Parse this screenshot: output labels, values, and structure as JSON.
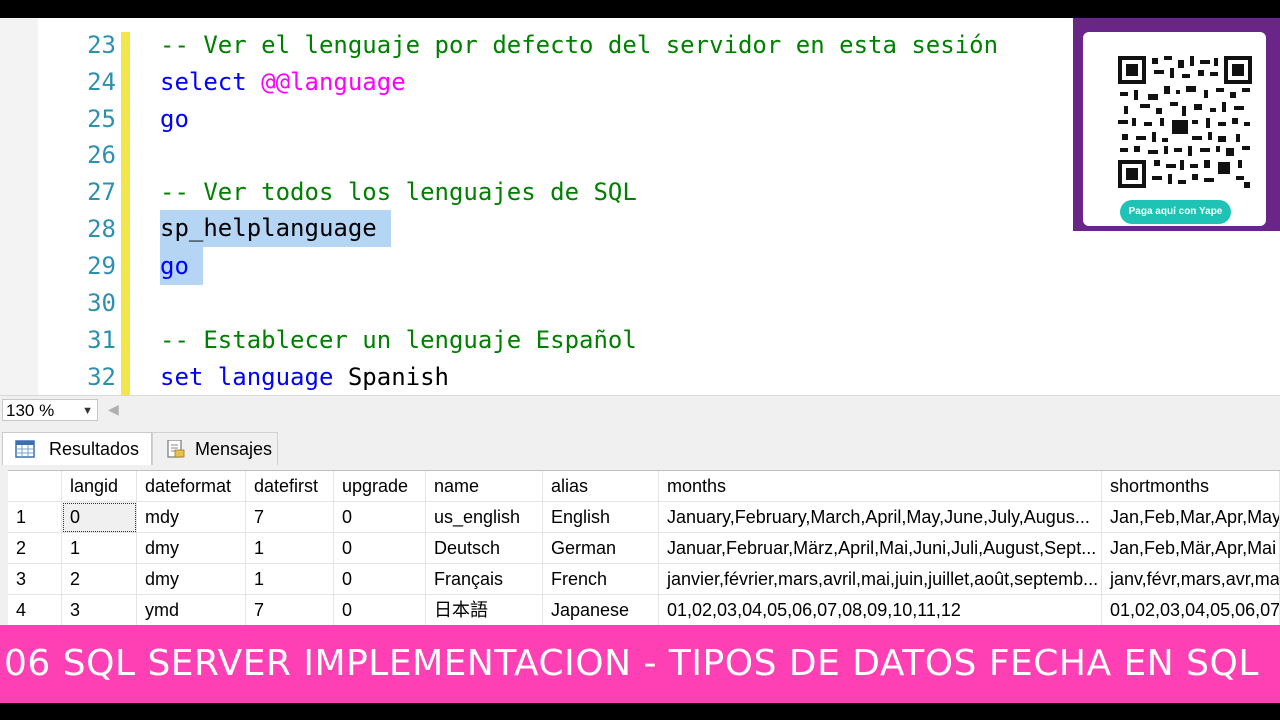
{
  "editor": {
    "lines": [
      {
        "num": "23",
        "text": "-- Ver el lenguaje por defecto del servidor en esta sesión"
      },
      {
        "num": "24",
        "kw": "select ",
        "var": "@@language"
      },
      {
        "num": "25",
        "kw": "go"
      },
      {
        "num": "26"
      },
      {
        "num": "27",
        "text": "-- Ver todos los lenguajes de SQL"
      },
      {
        "num": "28",
        "plain": "sp_helplanguage "
      },
      {
        "num": "29",
        "kw": "go "
      },
      {
        "num": "30"
      },
      {
        "num": "31",
        "text": "-- Establecer un lenguaje Español"
      },
      {
        "num": "32",
        "kw": "set language ",
        "plain": "Spanish"
      }
    ]
  },
  "qr": {
    "button_label": "Paga aquí con Yape"
  },
  "status": {
    "zoom": "130 %"
  },
  "tabs": {
    "results": "Resultados",
    "messages": "Mensajes"
  },
  "grid": {
    "headers": [
      "",
      "langid",
      "dateformat",
      "datefirst",
      "upgrade",
      "name",
      "alias",
      "months",
      "shortmonths"
    ],
    "rows": [
      [
        "1",
        "0",
        "mdy",
        "7",
        "0",
        "us_english",
        "English",
        "January,February,March,April,May,June,July,Augus...",
        "Jan,Feb,Mar,Apr,May"
      ],
      [
        "2",
        "1",
        "dmy",
        "1",
        "0",
        "Deutsch",
        "German",
        "Januar,Februar,März,April,Mai,Juni,Juli,August,Sept...",
        "Jan,Feb,Mär,Apr,Mai"
      ],
      [
        "3",
        "2",
        "dmy",
        "1",
        "0",
        "Français",
        "French",
        "janvier,février,mars,avril,mai,juin,juillet,août,septemb...",
        "janv,févr,mars,avr,ma"
      ],
      [
        "4",
        "3",
        "ymd",
        "7",
        "0",
        "日本語",
        "Japanese",
        "01,02,03,04,05,06,07,08,09,10,11,12",
        "01,02,03,04,05,06,07"
      ]
    ]
  },
  "banner": {
    "title": "06 SQL SERVER IMPLEMENTACION - TIPOS DE DATOS FECHA EN SQL"
  },
  "colors": {
    "banner": "#ff3fb4",
    "qr_frame": "#6a2589",
    "comment": "#008000",
    "keyword": "#0000ff",
    "variable": "#ff00ff",
    "line_number": "#2b91af",
    "selection": "#b5d5f5"
  }
}
